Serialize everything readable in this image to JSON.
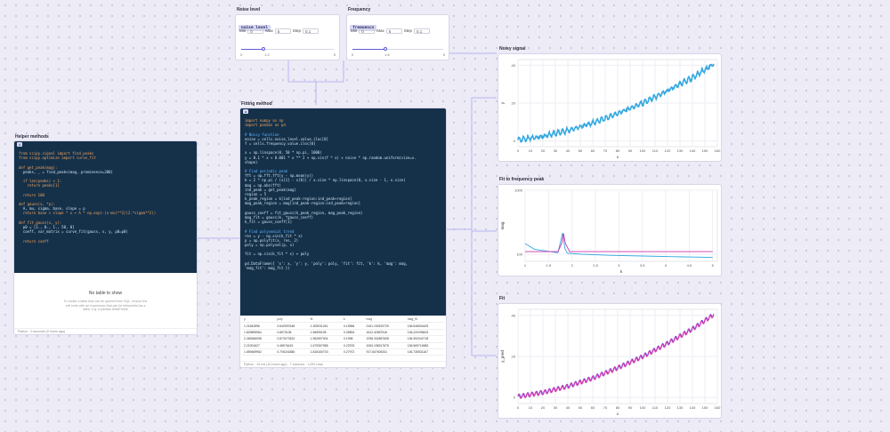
{
  "noise_panel": {
    "title": "Noise level",
    "var_name": "noise_level",
    "min_label": "Min",
    "min_value": "0",
    "max_label": "Max",
    "max_value": "5",
    "step_label": "Step",
    "step_value": "0.1",
    "value": "1.2",
    "low": "0",
    "high": "5",
    "fraction": 0.24
  },
  "freq_panel": {
    "title": "Frequency",
    "var_name": "frequency",
    "min_label": "Min",
    "min_value": "0",
    "max_label": "Max",
    "max_value": "5",
    "step_label": "Step",
    "step_value": "0.1",
    "value": "1.8",
    "low": "0",
    "high": "5",
    "fraction": 0.36
  },
  "helper": {
    "title": "Helper methods",
    "cell_id": "d",
    "code": [
      "from scipy.signal import find_peaks",
      "from scipy.optimize import curve_fit",
      "",
      "def get_peak(mag):",
      "  peaks, _ = find_peaks(mag, prominence=200)",
      "",
      "  if len(peaks) > 1:",
      "    return peaks[1]",
      "",
      "  return 100",
      "",
      "def gauss(x, *p):",
      "  A, mu, sigma, base, slope = p",
      "  return base + slope * x + A * np.exp(-(x-mu)**2/(2.*sigma**2))",
      "",
      "def fit_gauss(x, y):",
      "  p0 = [1., 0., 1., 50, 0]",
      "  coeff, var_matrix = curve_fit(gauss, x, y, p0=p0)",
      "",
      "  return coeff"
    ],
    "empty_title": "No table to show",
    "empty_text": "To create a table that can be queried from SQL, ensure the cell ends with an expression that can be interpreted as a table, e.g. a pandas DataFrame",
    "footer": "Python  ·  0 seconds (0 hours ago)"
  },
  "fitting": {
    "title": "Fitting method",
    "cell_id": "a",
    "code": [
      "import numpy as np",
      "import pandas as pd",
      "",
      "# Noisy function",
      "noise = cells.noise_level.value.iloc[0]",
      "f = cells.frequency.value.iloc[0]",
      "",
      "x = np.linspace(0, 50 * np.pi, 1000)",
      "y = 0.1 * x + 0.001 * x ** 2 + np.sin(f * x) + noise * np.random.uniform(size=x.",
      "shape)",
      "",
      "# Find periodic peak",
      "fft = np.fft.fft(y - np.mean(y))",
      "k = 2 * np.pi / (x[1] - x[0]) / x.size * np.linspace(0, x.size - 1, x.size)",
      "mag = np.abs(fft)",
      "ind_peak = get_peak(mag)",
      "region = 5",
      "k_peak_region = k[ind_peak-region:ind_peak+region]",
      "mag_peak_region = mag[ind_peak-region:ind_peak+region]",
      "",
      "gauss_coeff = fit_gauss(k_peak_region, mag_peak_region)",
      "mag_fit = gauss(k, *gauss_coeff)",
      "k_fit = gauss_coeff[1]",
      "",
      "# Find polynomial trend",
      "res = y - np.sin(k_fit * x)",
      "p = np.polyfit(x, res, 2)",
      "poly = np.polyval(p, x)",
      "",
      "fit = np.sin(k_fit * x) + poly",
      "",
      "pd.DataFrame({ 'x': x, 'y': y, 'poly': poly, 'fit': fit, 'k': k, 'mag': mag,",
      "'mag_fit': mag_fit })"
    ],
    "columns": [
      "y",
      "poly",
      "fit",
      "k",
      "mag",
      "mag_fit"
    ],
    "rows": [
      [
        "1.21842896",
        "0.640997648",
        "1.305031261",
        "0.15966",
        "2151.192676729",
        "136.546534429"
      ],
      [
        "1.829895984",
        "0.8575138",
        "1.56595195",
        "0.35894",
        "1612.42587516",
        "136.220298615"
      ],
      [
        "2.265366098",
        "0.873073324",
        "1.962597304",
        "0.1998",
        "1298.332867608",
        "136.392042718"
      ],
      [
        "2.21901627",
        "0.48976419",
        "1.679357988",
        "0.22976",
        "1063.198317675",
        "136.569716583"
      ],
      [
        "1.659469962",
        "0.705241886",
        "1.818160733",
        "0.27972",
        "917.847605331",
        "136.735531167"
      ]
    ],
    "footer": "Python  ·  24 ms (10 hours ago)  ·  7 columns · 1,000 rows"
  },
  "charts": {
    "noisy": {
      "title": "Noisy signal",
      "xlabel": "x",
      "ylabel": "y"
    },
    "fitpeak": {
      "title": "Fit to frequency peak",
      "xlabel": "k",
      "ylabel": "mag"
    },
    "fit": {
      "title": "Fit",
      "xlabel": "x",
      "ylabel": "y_pred"
    }
  },
  "chart_data": [
    {
      "type": "line",
      "title": "Noisy signal",
      "xlabel": "x",
      "ylabel": "y",
      "xlim": [
        0,
        160
      ],
      "ylim": [
        -3,
        43
      ],
      "xticks": [
        0,
        10,
        20,
        30,
        40,
        50,
        60,
        70,
        80,
        90,
        100,
        110,
        120,
        130,
        140,
        150,
        160
      ],
      "yticks": [
        0,
        20,
        40
      ],
      "series": [
        {
          "color": "#35a8e0",
          "x": [
            0,
            20,
            40,
            60,
            80,
            100,
            120,
            140,
            157
          ],
          "y": [
            0.5,
            2.5,
            5.5,
            9.5,
            14.5,
            20,
            26.5,
            33.5,
            40.5
          ]
        }
      ]
    },
    {
      "type": "line",
      "title": "Fit to frequency peak",
      "xlabel": "k",
      "ylabel": "mag",
      "xlim": [
        1,
        5.1
      ],
      "ylim": [
        0,
        1000
      ],
      "xticks": [
        1,
        1.5,
        2,
        2.5,
        3,
        3.5,
        4,
        4.5,
        5
      ],
      "yticks": [
        100,
        1000
      ],
      "series": [
        {
          "color": "#35a8e0",
          "x": [
            1,
            1.2,
            1.5,
            1.7,
            1.8,
            1.85,
            1.9,
            2.2,
            2.8,
            3.5,
            4.2,
            5
          ],
          "y": [
            250,
            170,
            140,
            120,
            400,
            180,
            115,
            100,
            85,
            75,
            65,
            55
          ]
        },
        {
          "color": "#cc33aa",
          "x": [
            1,
            1.7,
            1.78,
            1.82,
            1.86,
            1.95,
            5
          ],
          "y": [
            136,
            136,
            250,
            390,
            250,
            136,
            136
          ]
        }
      ]
    },
    {
      "type": "line",
      "title": "Fit",
      "xlabel": "x",
      "ylabel": "y_pred",
      "xlim": [
        0,
        160
      ],
      "ylim": [
        -3,
        43
      ],
      "xticks": [
        0,
        10,
        20,
        30,
        40,
        50,
        60,
        70,
        80,
        90,
        100,
        110,
        120,
        130,
        140,
        150,
        160
      ],
      "yticks": [
        0,
        20,
        40
      ],
      "series": [
        {
          "color": "#4f4fe0",
          "x": [
            0,
            20,
            40,
            60,
            80,
            100,
            120,
            140,
            157
          ],
          "y": [
            0.5,
            2.5,
            5.5,
            9.5,
            14.5,
            20,
            26.5,
            33.5,
            40.5
          ]
        },
        {
          "color": "#e040b0",
          "x": [
            0,
            20,
            40,
            60,
            80,
            100,
            120,
            140,
            157
          ],
          "y": [
            0.3,
            2.3,
            5.3,
            9.3,
            14.3,
            19.8,
            26.3,
            33.3,
            40.3
          ]
        }
      ]
    }
  ],
  "colors": {
    "code_bg": "#15314a",
    "accent": "#5b5bd6",
    "signal": "#35a8e0",
    "fit": "#e040b0",
    "connector": "#b8b6f0"
  }
}
